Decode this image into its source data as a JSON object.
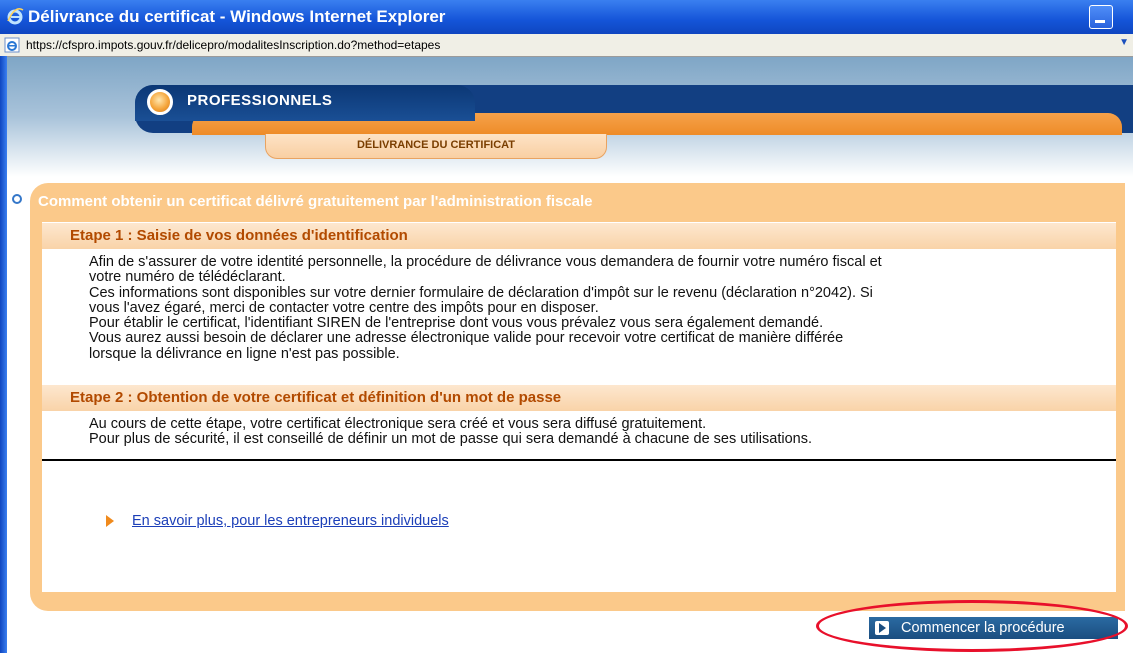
{
  "window": {
    "title": "Délivrance du certificat - Windows Internet Explorer",
    "url": "https://cfspro.impots.gouv.fr/delicepro/modalitesInscription.do?method=etapes"
  },
  "header": {
    "section": "PROFESSIONNELS",
    "subsection": "DÉLIVRANCE DU CERTIFICAT"
  },
  "main": {
    "title": "Comment obtenir un certificat délivré gratuitement par l'administration fiscale",
    "etape1": {
      "heading": "Etape 1 : Saisie de vos données d'identification",
      "lines": [
        "Afin de s'assurer de votre identité personnelle, la procédure de délivrance vous demandera de fournir votre numéro fiscal et",
        "votre numéro de télédéclarant.",
        "Ces informations sont disponibles sur votre dernier formulaire de déclaration d'impôt sur le revenu (déclaration n°2042). Si",
        "vous l'avez égaré, merci de contacter votre centre des impôts pour en disposer.",
        "Pour établir le certificat, l'identifiant SIREN de l'entreprise dont vous vous prévalez vous sera également demandé.",
        "Vous aurez aussi besoin de déclarer une adresse électronique valide pour recevoir votre certificat de manière différée",
        "lorsque la délivrance en ligne n'est pas possible."
      ]
    },
    "etape2": {
      "heading": "Etape 2 : Obtention de votre certificat et définition d'un mot de passe",
      "lines": [
        "Au cours de cette étape, votre certificat électronique sera créé et vous sera diffusé gratuitement.",
        "Pour plus de sécurité, il est conseillé de définir un mot de passe qui sera demandé à chacune de ses utilisations."
      ]
    },
    "link": "En savoir plus, pour les entrepreneurs individuels"
  },
  "actions": {
    "start": "Commencer la procédure"
  },
  "colors": {
    "accent_orange": "#f08a1c",
    "nav_blue": "#123f82",
    "highlight_red": "#e8102b"
  }
}
